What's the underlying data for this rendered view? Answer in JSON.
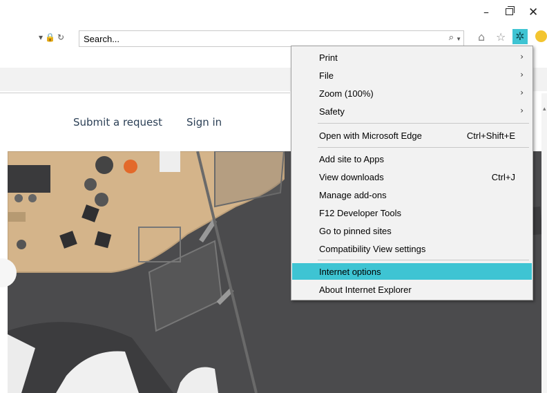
{
  "toolbar": {
    "search_placeholder": "Search...",
    "search_go_icon": "⌕",
    "home_icon": "⌂",
    "favorites_icon": "☆",
    "tools_icon": "✲"
  },
  "page": {
    "nav": {
      "submit_request": "Submit a request",
      "sign_in": "Sign in"
    }
  },
  "menu": {
    "items": [
      {
        "label": "Print",
        "arrow": "›"
      },
      {
        "label": "File",
        "arrow": "›"
      },
      {
        "label": "Zoom (100%)",
        "arrow": "›"
      },
      {
        "label": "Safety",
        "arrow": "›"
      },
      {
        "label": "Open with Microsoft Edge",
        "shortcut": "Ctrl+Shift+E"
      },
      {
        "label": "Add site to Apps"
      },
      {
        "label": "View downloads",
        "shortcut": "Ctrl+J"
      },
      {
        "label": "Manage add-ons"
      },
      {
        "label": "F12 Developer Tools"
      },
      {
        "label": "Go to pinned sites"
      },
      {
        "label": "Compatibility View settings"
      },
      {
        "label": "Internet options"
      },
      {
        "label": "About Internet Explorer"
      }
    ]
  },
  "colors": {
    "highlight": "#3ec4d3",
    "nav_link": "#2b3f55",
    "menu_bg": "#f2f2f2"
  }
}
